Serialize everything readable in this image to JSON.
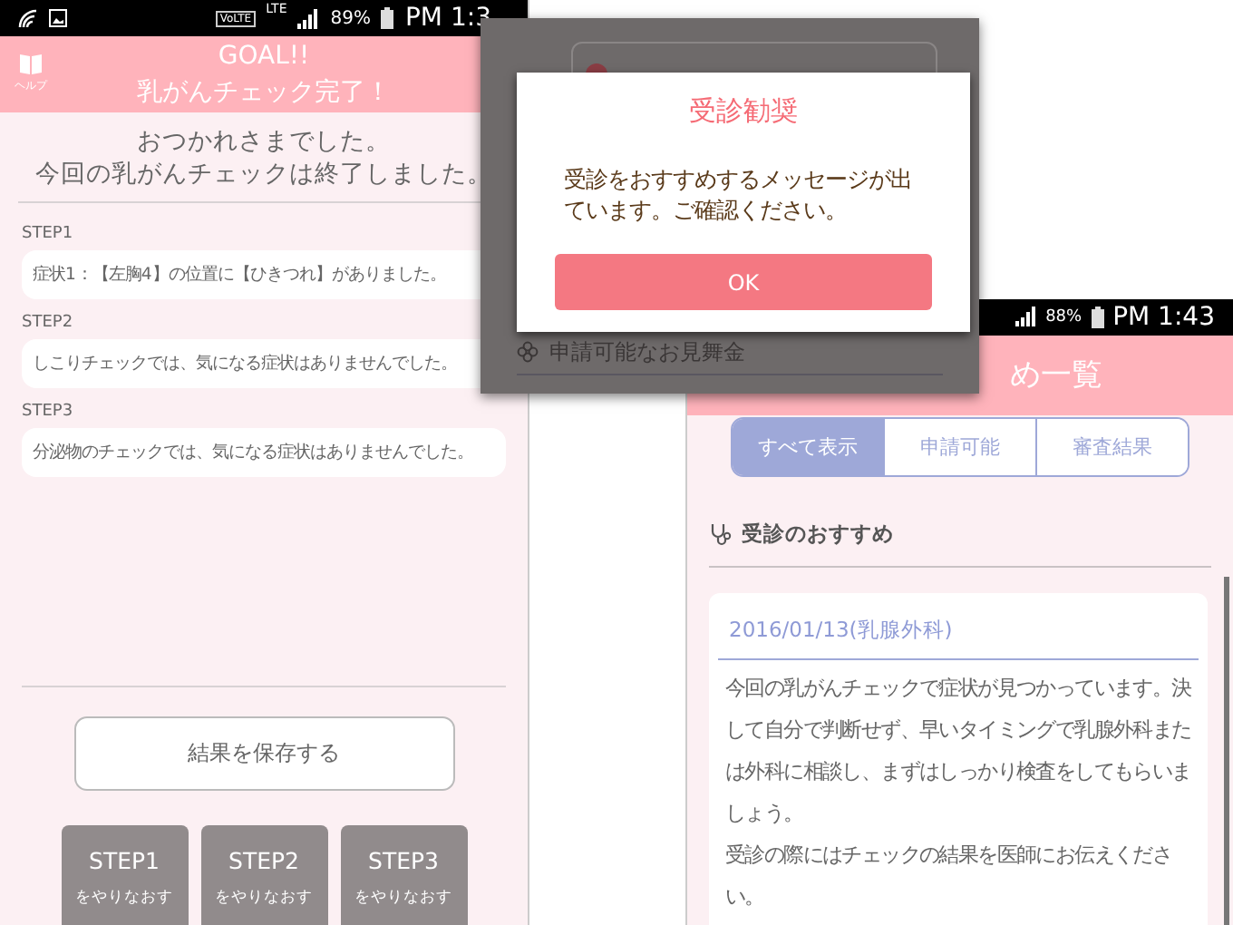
{
  "goal_screen": {
    "status_bar": {
      "volte": "VoLTE",
      "network": "LTE",
      "battery": "89%",
      "time": "PM 1:3"
    },
    "help_label": "ヘルプ",
    "title": "GOAL!!",
    "subtitle": "乳がんチェック完了！",
    "message": [
      "おつかれさまでした。",
      "今回の乳がんチェックは終了しました。"
    ],
    "steps": [
      {
        "label": "STEP1",
        "result": "症状1：【左胸4】の位置に【ひきつれ】がありました。"
      },
      {
        "label": "STEP2",
        "result": "しこりチェックでは、気になる症状はありませんでした。"
      },
      {
        "label": "STEP3",
        "result": "分泌物のチェックでは、気になる症状はありませんでした。"
      }
    ],
    "save_button": "結果を保存する",
    "redo_buttons": [
      {
        "step": "STEP1",
        "action": "をやりなおす"
      },
      {
        "step": "STEP2",
        "action": "をやりなおす"
      },
      {
        "step": "STEP3",
        "action": "をやりなおす"
      }
    ]
  },
  "dialog_screen": {
    "dialog": {
      "title": "受診勧奨",
      "message": "受診をおすすめするメッセージが出ています。ご確認ください。",
      "ok_button": "OK"
    },
    "section": "申請可能なお見舞金"
  },
  "list_screen": {
    "status_bar": {
      "battery": "88%",
      "time": "PM 1:43"
    },
    "title": "め一覧",
    "filters": [
      {
        "label": "すべて表示",
        "selected": true
      },
      {
        "label": "申請可能",
        "selected": false
      },
      {
        "label": "審査結果",
        "selected": false
      }
    ],
    "section": "受診のおすすめ",
    "entries": [
      {
        "date": "2016/01/13(乳腺外科)",
        "paragraphs": [
          "今回の乳がんチェックで症状が見つかっています。決して自分で判断せず、早いタイミングで乳腺外科または外科に相談し、まずはしっかり検査をしてもらいましょう。",
          "受診の際にはチェックの結果を医師にお伝えください。"
        ]
      }
    ]
  }
}
